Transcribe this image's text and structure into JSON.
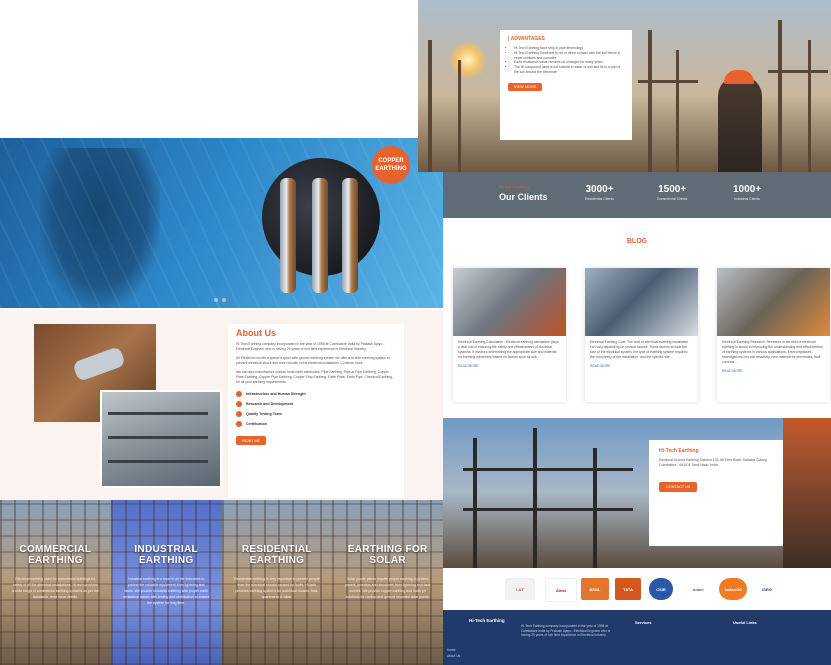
{
  "hero": {
    "badge": "COPPER EARTHING"
  },
  "about": {
    "title": "About Us",
    "paragraphs": [
      "Hi-Tech Earthing company incorporated in the year of 1998 at Coimbatore India by Prakash Ajayo - Electrical Engineer who is having 25 years of rich field experience in Electrical Industry.",
      "All Electrical circuits required a good safe ground earthing system we offer a hi-tech earthing system to prevent electrical shock and short circuits in the electrical installation. Continue more",
      "We can also manufacture custom build earth electrodes: Pipe Earthing, Pipe-in-Pipe Earthing, Copper Plate Earthing, Copper Pipe Earthing, Copper Strip Earthing, Earth Plate, Earth Pipe, Chemical Earthing, for all your earthing requirements."
    ],
    "features": [
      "Infrastructure and Human Strength",
      "Research and Development",
      "Quality Testing Team",
      "Certification"
    ],
    "button": "READ ME"
  },
  "services": [
    {
      "title": "COMMERCIAL EARTHING",
      "desc": "Electrical earthing used for commercial buildings for safety of all the electrical installations. Hi-tech provides a wide range of commercial earthing systems as per the standards, read more details."
    },
    {
      "title": "INDUSTRIAL EARTHING",
      "desc": "Industrial earthing is a must in all the industries to protect the valuable equipment from lightning and faults. We provide industrial earthing with proper earth resistance values with testing and certification to ensure the system for long time."
    },
    {
      "title": "RESIDENTIAL EARTHING",
      "desc": "Residential earthing is very important to prevent people from the electrical shocks caused by faults. Hi-tech provides earthing systems for individual houses, flats, apartments & villas."
    },
    {
      "title": "EARTHING FOR SOLAR",
      "desc": "Solar power plants require proper earthing to protect panels, inverters and structures from lightning and fault current. We provide copper earthing and earth pit solutions for rooftop and ground mounted solar plants."
    }
  ],
  "advantages": {
    "title": "| ADVANTAGES",
    "items": [
      "Hi-Tech Earthing have strip in pipe technology",
      "Hi-Tech Earthing Electrode is not in direct contact with the soil hence it never oxidises and corrodes",
      "Earth resistance value remains un-changed for many years",
      "The fill compound used is not soluble in water or soil and its is a part of the soil around the electrode"
    ],
    "button": "VIEW MORE"
  },
  "clients": {
    "label": "Hi-Tech Earthing",
    "title": "Our Clients",
    "stats": [
      {
        "num": "3000+",
        "cap": "Residential Clients"
      },
      {
        "num": "1500+",
        "cap": "Commercial Clients"
      },
      {
        "num": "1000+",
        "cap": "Industrial Clients"
      }
    ]
  },
  "blog": {
    "title": "BLOG",
    "posts": [
      {
        "text": "Electrical Earthing Calculation : Electrical earthing calculation plays a vital role in ensuring the safety and effectiveness of electrical systems. It involves determining the appropriate size and material for earthing electrodes based on factors such as soil...",
        "more": "READ MORE"
      },
      {
        "text": "Electrical Earthing Cost: The cost of electrical earthing installation can vary depending on several factors. These factors include the size of the electrical system, the type of earthing system required, the complexity of the installation, and the specific site...",
        "more": "READ MORE"
      },
      {
        "text": "Electrical Earthing Research: Research in the field of electrical earthing is aimed at improving the understanding and effectiveness of earthing systems in various applications. It encompasses investigations into soil resistivity, new material for electrodes, fault currents...",
        "more": "READ MORE"
      }
    ]
  },
  "contact": {
    "title": "Hi-Tech Earthing",
    "address": "Electrical Ground Earthing Solution 123, 60 Feet Road, Saibaba Colony, Coimbatore - 641011 Tamil Nadu, India.",
    "button": "CONTACT US"
  },
  "logos": [
    "L&T",
    "Airtel",
    "BSNL",
    "TATA",
    "CSIR",
    "Adani",
    "IndianOil",
    "ISRO"
  ],
  "footer": {
    "brand": "Hi-Tech Earthing",
    "links": [
      "Home",
      "About Us"
    ],
    "about": "Hi-Tech Earthing company incorporated in the year of 1998 at Coimbatore India by Prakash Ajayo - Electrical Engineer who is having 25 years of rich field experience in Electrical Industry.",
    "col2_title": "Services",
    "col3_title": "Useful Links"
  }
}
